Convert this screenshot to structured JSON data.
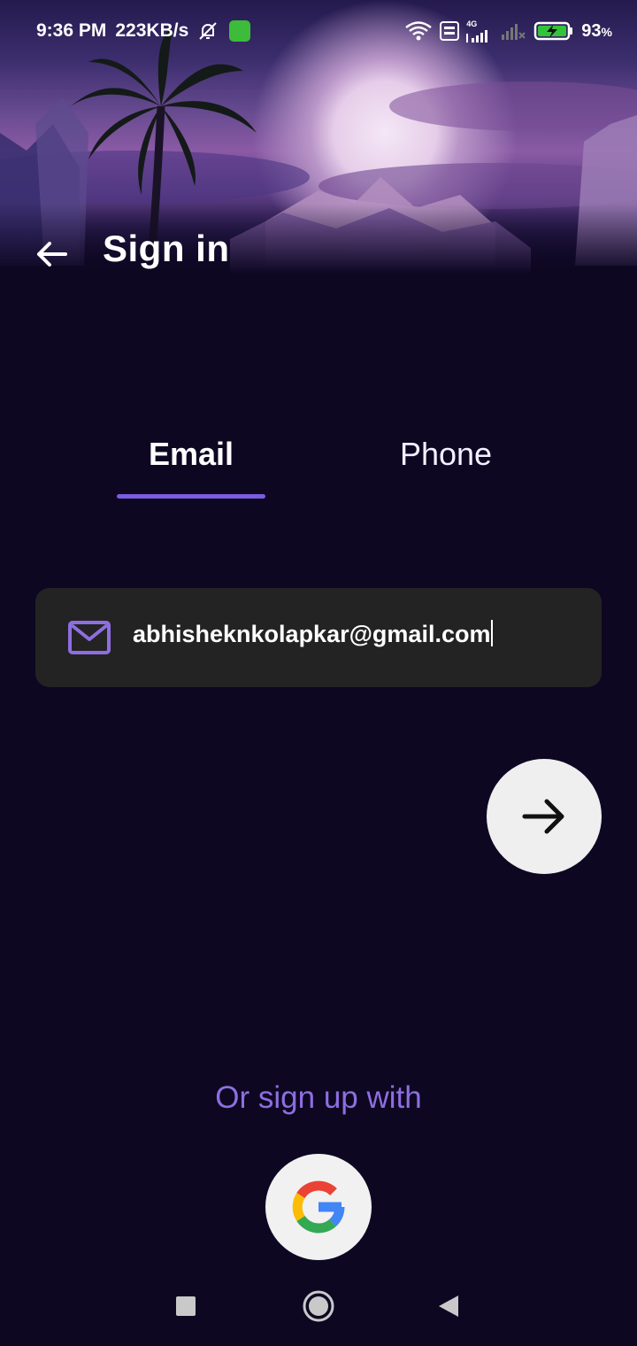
{
  "status_bar": {
    "time": "9:36 PM",
    "speed": "223KB/s",
    "network_label": "4G",
    "battery": "93",
    "battery_unit": "%",
    "icons": [
      "mute-icon",
      "app-notification-icon",
      "wifi-icon",
      "volte-icon",
      "signal-icon",
      "signal-empty-icon",
      "battery-charging-icon"
    ]
  },
  "app_bar": {
    "title": "Sign in",
    "back_icon": "arrow-left-icon"
  },
  "tabs": [
    {
      "label": "Email",
      "selected": true
    },
    {
      "label": "Phone",
      "selected": false
    }
  ],
  "email_field": {
    "icon": "mail-icon",
    "value": "abhisheknkolapkar@gmail.com"
  },
  "next_button": {
    "icon": "arrow-right-icon"
  },
  "signup": {
    "label": "Or sign up with",
    "google_icon": "google-icon"
  },
  "nav_bar": {
    "icons": [
      "recents-square-icon",
      "home-circle-icon",
      "back-triangle-icon"
    ]
  },
  "colors": {
    "background": "#0d0722",
    "accent": "#7b5ce0",
    "signup_text": "#8e6ee0",
    "field_bg": "#232323",
    "button_bg": "#efefef"
  }
}
